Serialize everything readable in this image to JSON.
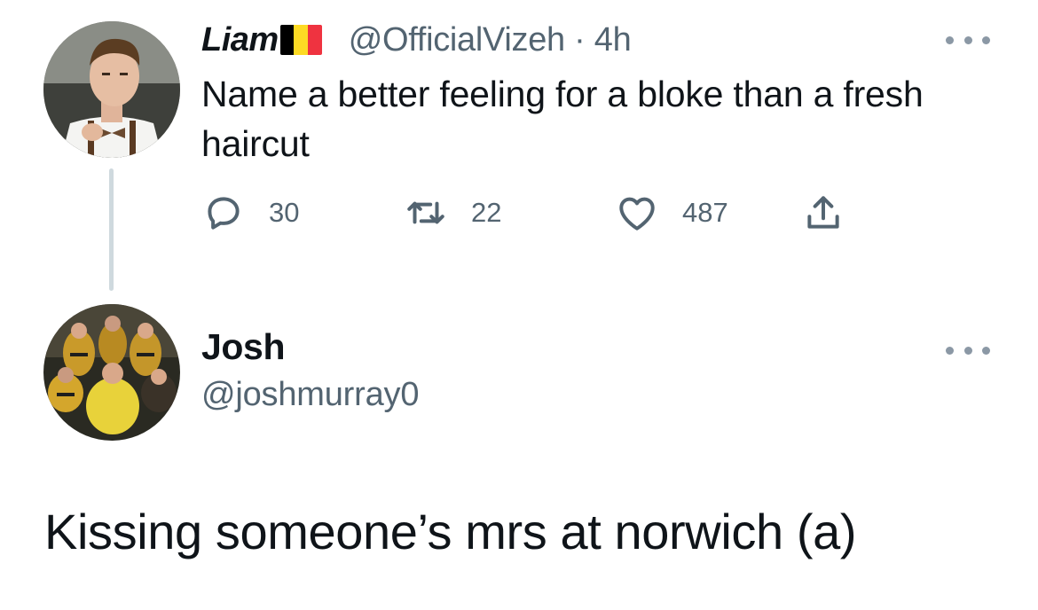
{
  "parent_tweet": {
    "author": {
      "display_name": "Liam",
      "flag": "Belgium",
      "flag_colors": [
        "#000000",
        "#FDDA24",
        "#EF3340"
      ],
      "handle": "@OfficialVizeh",
      "separator": "·",
      "time": "4h",
      "handle_time": "@OfficialVizeh · 4h"
    },
    "text": "Name a better feeling for a bloke than a fresh haircut",
    "actions": {
      "reply_count": "30",
      "retweet_count": "22",
      "like_count": "487"
    },
    "icons": {
      "reply": "reply-icon",
      "retweet": "retweet-icon",
      "like": "heart-icon",
      "share": "share-icon",
      "more": "more-icon"
    }
  },
  "reply_tweet": {
    "author": {
      "display_name": "Josh",
      "handle": "@joshmurray0"
    },
    "text": "Kissing someone’s mrs at norwich (a)"
  },
  "colors": {
    "text_primary": "#0f1419",
    "text_secondary": "#536471",
    "thread_line": "#cfd9de",
    "background": "#ffffff"
  }
}
